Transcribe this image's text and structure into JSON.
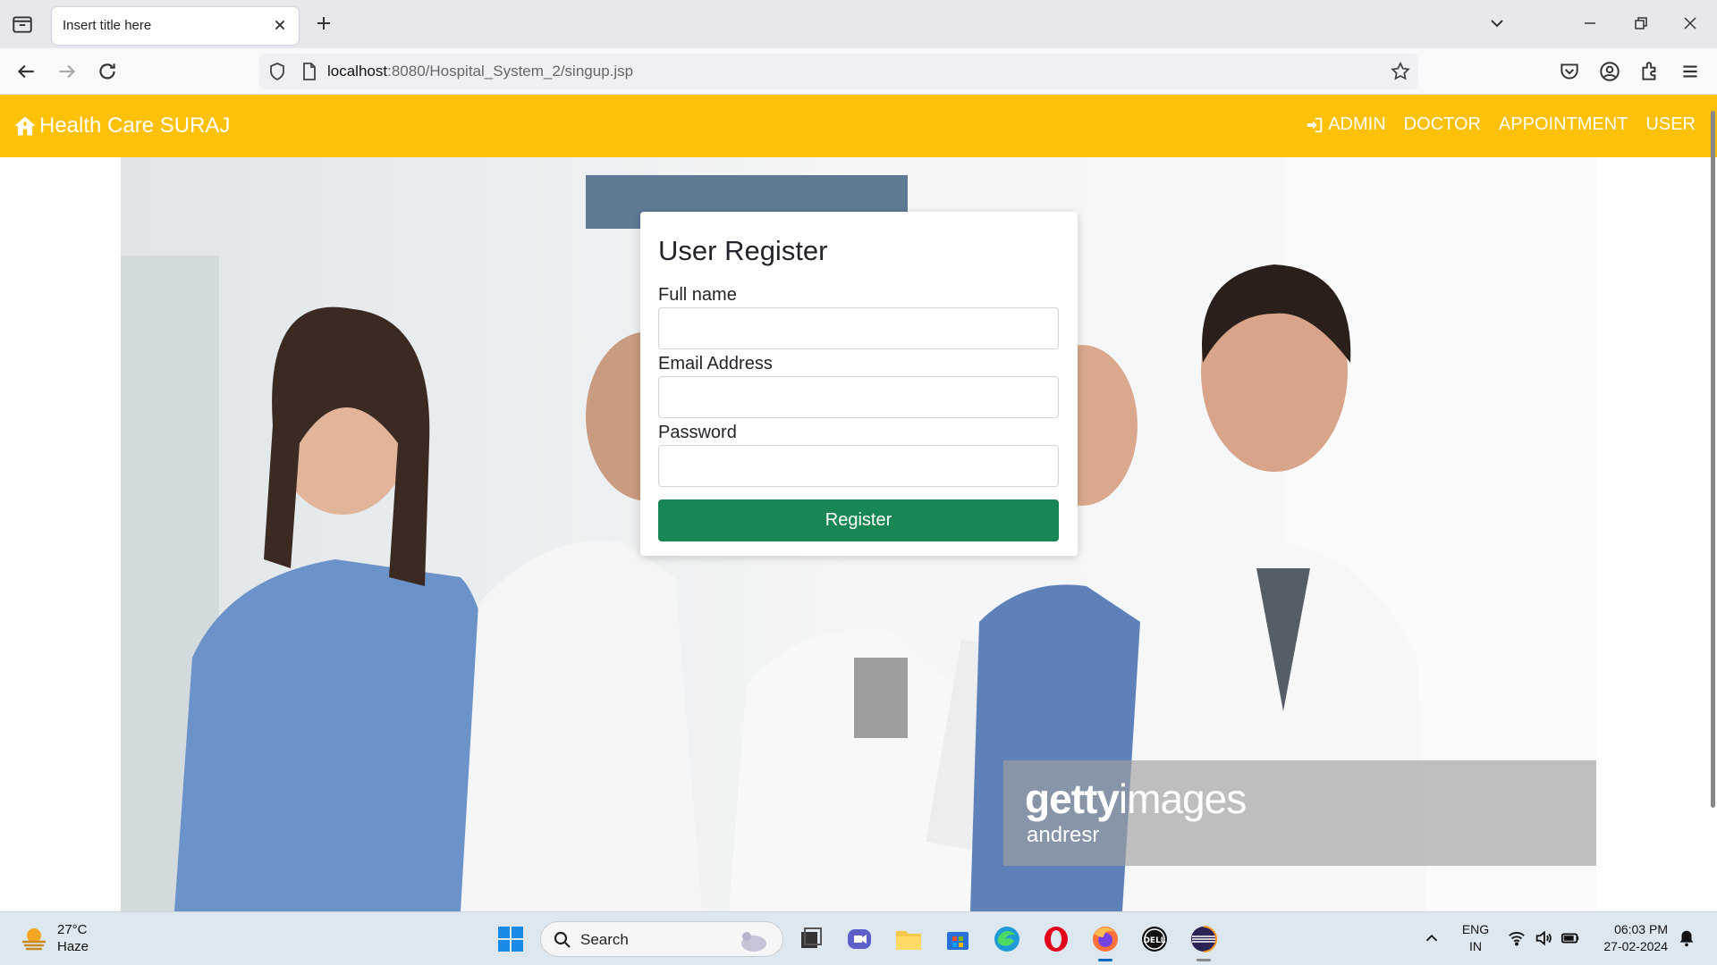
{
  "browser": {
    "tab_title": "Insert title here",
    "url_host": "localhost",
    "url_rest": ":8080/Hospital_System_2/singup.jsp"
  },
  "site": {
    "brand": "Health Care SURAJ",
    "nav": [
      {
        "label": "ADMIN"
      },
      {
        "label": "DOCTOR"
      },
      {
        "label": "APPOINTMENT"
      },
      {
        "label": "USER"
      }
    ],
    "accent_color": "#ffc107"
  },
  "form": {
    "title": "User Register",
    "full_name_label": "Full name",
    "full_name_value": "",
    "email_label": "Email Address",
    "email_value": "",
    "password_label": "Password",
    "password_value": "",
    "submit_label": "Register",
    "submit_color": "#198754"
  },
  "hero": {
    "watermark_brand_bold": "getty",
    "watermark_brand_light": "images",
    "watermark_credit": "andresr"
  },
  "taskbar": {
    "temperature": "27°C",
    "condition": "Haze",
    "search_label": "Search",
    "lang_top": "ENG",
    "lang_bottom": "IN",
    "time": "06:03 PM",
    "date": "27-02-2024"
  }
}
